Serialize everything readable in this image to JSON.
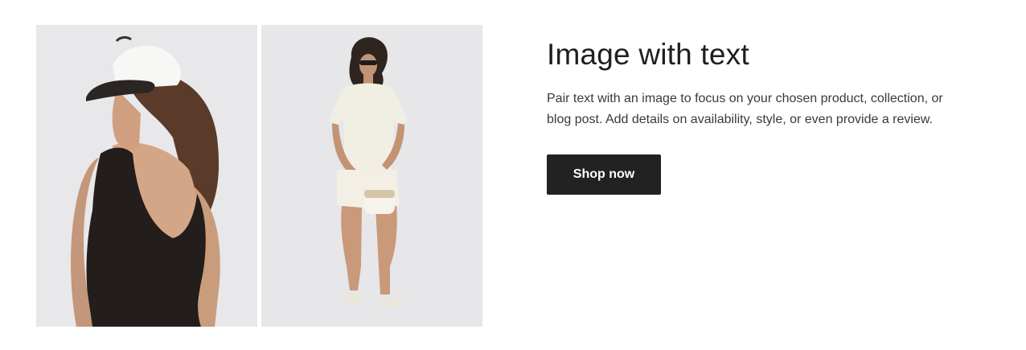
{
  "section": {
    "heading": "Image with text",
    "body": "Pair text with an image to focus on your chosen product, collection, or blog post. Add details on availability, style, or even provide a review.",
    "button_label": "Shop now"
  },
  "images": [
    {
      "name": "woman-black-bodysuit-white-cap",
      "background": "#e7e6e9"
    },
    {
      "name": "woman-cream-shirt-shorts-handbag",
      "background": "#e6e5e8"
    }
  ],
  "colors": {
    "button_bg": "#222222",
    "button_text": "#ffffff",
    "heading": "#1f1f1f",
    "body": "#3a3a3a"
  }
}
